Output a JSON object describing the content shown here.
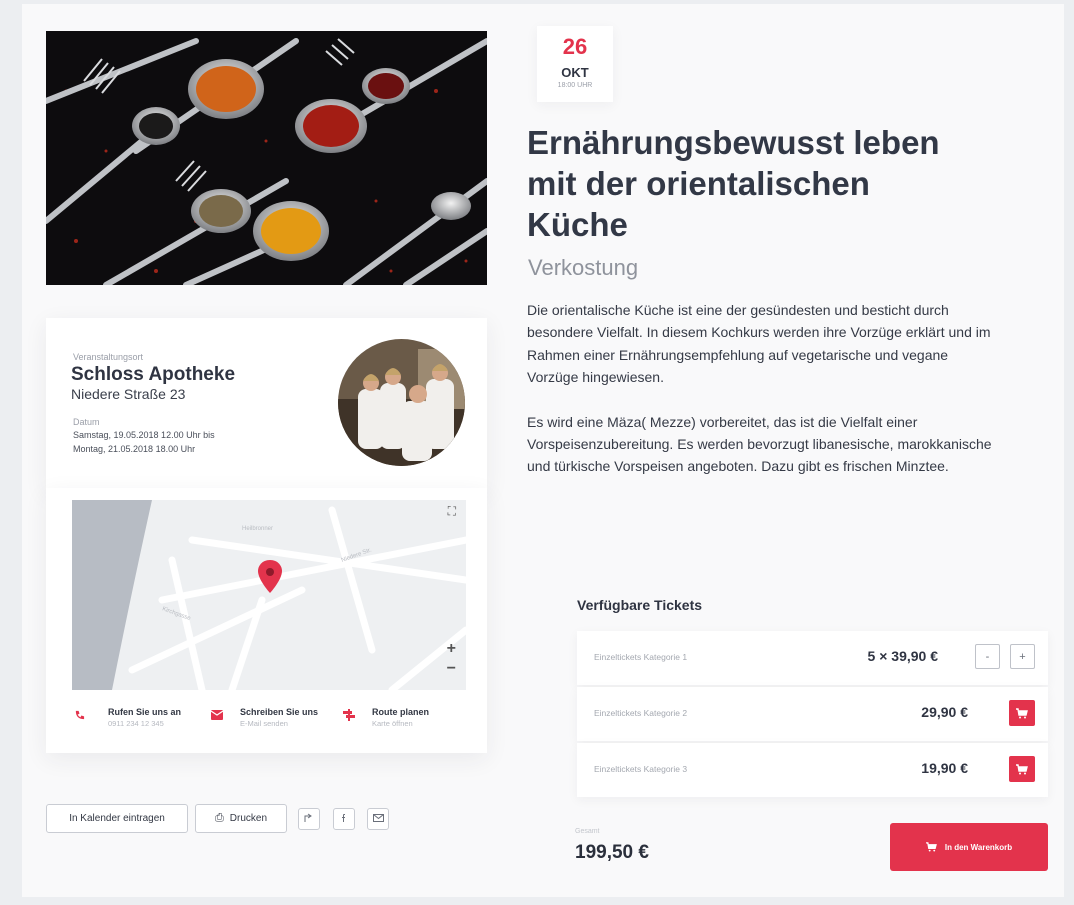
{
  "event": {
    "day": "26",
    "month": "OKT",
    "time": "18:00 UHR",
    "title": "Ernährungsbewusst leben mit der orientalischen Küche",
    "subtitle": "Verkostung",
    "description": [
      "Die orientalische Küche ist eine der gesündesten und besticht durch besondere Vielfalt. In diesem Kochkurs werden ihre Vorzüge erklärt und im Rahmen einer Ernährungsempfehlung auf vegetarische und vegane Vorzüge hingewiesen.",
      "Es wird eine Mäza( Mezze) vorbereitet, das ist die Vielfalt einer Vorspeisenzubereitung. Es werden bevorzugt libanesische, marokkanische und türkische Vorspeisen angeboten. Dazu gibt es frischen Minztee."
    ]
  },
  "venue": {
    "label": "Veranstaltungsort",
    "name": "Schloss Apotheke",
    "street": "Niedere Straße 23",
    "date_label": "Datum",
    "date_line1": "Samstag, 19.05.2018 12.00 Uhr bis",
    "date_line2": "Montag, 21.05.2018 18.00 Uhr"
  },
  "map": {
    "zoom_in": "+",
    "zoom_out": "−",
    "fullscreen": "⛶",
    "pin_color": "#e3334c"
  },
  "contacts": [
    {
      "title": "Rufen Sie uns an",
      "sub": "0911 234 12 345",
      "icon": "phone-icon"
    },
    {
      "title": "Schreiben Sie uns",
      "sub": "E-Mail senden",
      "icon": "mail-icon"
    },
    {
      "title": "Route planen",
      "sub": "Karte öffnen",
      "icon": "route-icon"
    }
  ],
  "actions": {
    "calendar": "In Kalender eintragen",
    "print": "Drucken",
    "print_icon": "⎙"
  },
  "tickets": {
    "heading": "Verfügbare Tickets",
    "rows": [
      {
        "name": "Einzeltickets Kategorie 1",
        "price": "5 × 39,90 €"
      },
      {
        "name": "Einzeltickets Kategorie 2",
        "price": "29,90 €"
      },
      {
        "name": "Einzeltickets Kategorie 3",
        "price": "19,90 €"
      }
    ],
    "minus": "-",
    "plus": "+"
  },
  "total": {
    "label": "Gesamt",
    "value": "199,50 €"
  },
  "basket_button": "In den Warenkorb",
  "colors": {
    "accent": "#e3334c",
    "text": "#2f3442",
    "muted": "#9a9ea8"
  }
}
